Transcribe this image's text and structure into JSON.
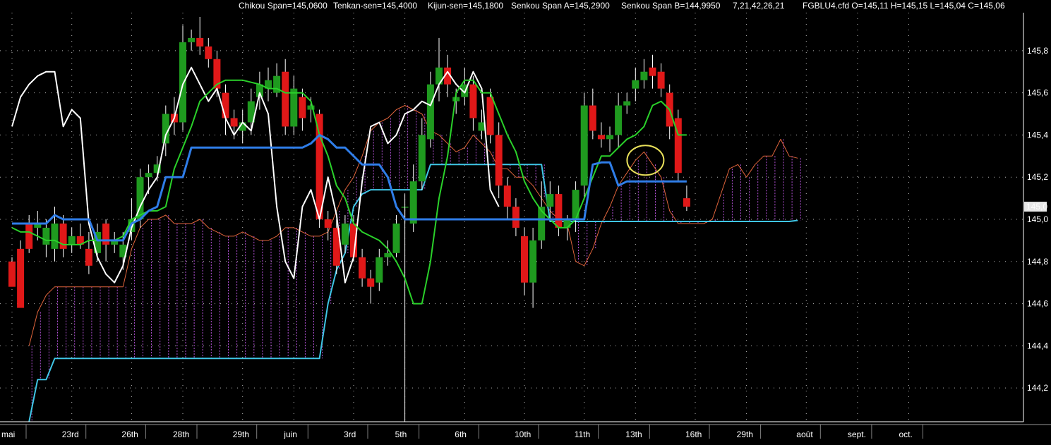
{
  "header": {
    "chikou": "Chikou Span=145,0600",
    "tenkan": "Tenkan-sen=145,4000",
    "kijun": "Kijun-sen=145,1800",
    "senkou_a": "Senkou Span A=145,2900",
    "senkou_b": "Senkou Span B=144,9950",
    "params": "7,21,42,26,21",
    "ohlc": "FGBLU4.cfd O=145,11 H=145,15 L=145,04 C=145,06"
  },
  "colors": {
    "background": "#000000",
    "bull": "#1f9a1f",
    "bear": "#e01818",
    "chikou": "#ffffff",
    "tenkan": "#2ad12a",
    "kijun": "#2f7de8",
    "senkou_a": "#e0643c",
    "senkou_b": "#3fc6e6",
    "cloud_hatch": "#b452d8",
    "highlight_circle": "#e8e05a",
    "grid": "#ffffff"
  },
  "chart_data": {
    "type": "candlestick",
    "instrument": "FGBLU4.cfd",
    "ylim": [
      144.04,
      145.98
    ],
    "y_ticks": [
      144.2,
      144.4,
      144.6,
      144.8,
      145.0,
      145.2,
      145.4,
      145.6,
      145.8
    ],
    "y_tick_labels": [
      "144,2",
      "144,4",
      "144,6",
      "144,8",
      "145,0",
      "145,2",
      "145,4",
      "145,6",
      "145,8"
    ],
    "last_price": 145.06,
    "last_price_label": "145,0",
    "n_slots": 107,
    "x_labels": [
      {
        "slot": 0,
        "label": "mai"
      },
      {
        "slot": 7,
        "label": "23rd"
      },
      {
        "slot": 14,
        "label": "26th"
      },
      {
        "slot": 20,
        "label": "28th"
      },
      {
        "slot": 27,
        "label": "29th"
      },
      {
        "slot": 33,
        "label": "juin"
      },
      {
        "slot": 40,
        "label": "3rd"
      },
      {
        "slot": 46,
        "label": "5th"
      },
      {
        "slot": 53,
        "label": "6th"
      },
      {
        "slot": 60,
        "label": "10th"
      },
      {
        "slot": 67,
        "label": "11th"
      },
      {
        "slot": 73,
        "label": "13th"
      },
      {
        "slot": 80,
        "label": "16th"
      },
      {
        "slot": 86,
        "label": "29th"
      },
      {
        "slot": 93,
        "label": "août"
      },
      {
        "slot": 99,
        "label": "sept."
      },
      {
        "slot": 105,
        "label": "oct."
      }
    ],
    "candles": [
      [
        144.8,
        144.68,
        144.82,
        144.7
      ],
      [
        144.86,
        144.58,
        144.9,
        144.66
      ],
      [
        144.98,
        144.86,
        145.02,
        144.84
      ],
      [
        144.96,
        144.98,
        145.04,
        144.9
      ],
      [
        144.88,
        144.96,
        145.0,
        144.82
      ],
      [
        144.86,
        144.98,
        145.06,
        144.8
      ],
      [
        144.98,
        144.86,
        145.02,
        144.82
      ],
      [
        144.88,
        144.92,
        144.96,
        144.84
      ],
      [
        144.92,
        144.88,
        144.98,
        144.86
      ],
      [
        144.86,
        144.78,
        144.94,
        144.74
      ],
      [
        144.84,
        144.94,
        144.98,
        144.8
      ],
      [
        144.98,
        144.88,
        145.0,
        144.8
      ],
      [
        144.88,
        144.9,
        144.94,
        144.84
      ],
      [
        144.82,
        144.88,
        144.94,
        144.76
      ],
      [
        144.94,
        145.0,
        145.1,
        144.9
      ],
      [
        145.0,
        145.2,
        145.24,
        144.96
      ],
      [
        145.2,
        145.22,
        145.26,
        145.12
      ],
      [
        145.22,
        145.26,
        145.3,
        145.18
      ],
      [
        145.36,
        145.5,
        145.54,
        145.3
      ],
      [
        145.5,
        145.46,
        145.58,
        145.4
      ],
      [
        145.46,
        145.84,
        145.92,
        145.42
      ],
      [
        145.84,
        145.86,
        145.9,
        145.8
      ],
      [
        145.86,
        145.82,
        145.96,
        145.78
      ],
      [
        145.82,
        145.76,
        145.86,
        145.72
      ],
      [
        145.76,
        145.62,
        145.8,
        145.58
      ],
      [
        145.6,
        145.48,
        145.64,
        145.4
      ],
      [
        145.48,
        145.44,
        145.52,
        145.38
      ],
      [
        145.42,
        145.46,
        145.52,
        145.36
      ],
      [
        145.46,
        145.56,
        145.62,
        145.4
      ],
      [
        145.58,
        145.64,
        145.7,
        145.52
      ],
      [
        145.62,
        145.66,
        145.72,
        145.56
      ],
      [
        145.6,
        145.68,
        145.74,
        145.58
      ],
      [
        145.7,
        145.44,
        145.76,
        145.4
      ],
      [
        145.44,
        145.62,
        145.68,
        145.4
      ],
      [
        145.58,
        145.48,
        145.62,
        145.42
      ],
      [
        145.52,
        145.54,
        145.58,
        145.46
      ],
      [
        145.5,
        145.0,
        145.52,
        144.96
      ],
      [
        145.0,
        144.96,
        145.04,
        144.9
      ],
      [
        144.96,
        144.78,
        145.0,
        144.74
      ],
      [
        144.88,
        144.98,
        145.02,
        144.84
      ],
      [
        144.98,
        144.82,
        145.02,
        144.8
      ],
      [
        144.82,
        144.72,
        144.86,
        144.68
      ],
      [
        144.72,
        144.68,
        144.76,
        144.6
      ],
      [
        144.7,
        144.82,
        144.86,
        144.66
      ],
      [
        144.82,
        144.84,
        144.9,
        144.78
      ],
      [
        144.84,
        144.98,
        145.02,
        144.82
      ],
      [
        145.06,
        145.06,
        145.12,
        144.98
      ],
      [
        144.98,
        145.18,
        145.26,
        144.94
      ],
      [
        145.18,
        145.4,
        145.48,
        145.14
      ],
      [
        145.38,
        145.64,
        145.7,
        145.34
      ],
      [
        145.64,
        145.72,
        145.86,
        145.56
      ],
      [
        145.72,
        145.64,
        145.78,
        145.58
      ],
      [
        145.56,
        145.58,
        145.62,
        145.5
      ],
      [
        145.58,
        145.64,
        145.72,
        145.54
      ],
      [
        145.64,
        145.48,
        145.68,
        145.42
      ],
      [
        145.42,
        145.46,
        145.52,
        145.38
      ],
      [
        145.58,
        145.4,
        145.62,
        145.36
      ],
      [
        145.4,
        145.16,
        145.46,
        145.1
      ],
      [
        145.16,
        145.06,
        145.2,
        145.0
      ],
      [
        145.06,
        144.96,
        145.1,
        144.92
      ],
      [
        144.92,
        144.7,
        144.96,
        144.64
      ],
      [
        144.7,
        144.9,
        144.96,
        144.58
      ],
      [
        144.9,
        145.06,
        145.18,
        144.86
      ],
      [
        145.06,
        145.12,
        145.18,
        145.0
      ],
      [
        145.12,
        144.96,
        145.16,
        144.92
      ],
      [
        144.96,
        145.0,
        145.02,
        144.9
      ],
      [
        145.0,
        145.14,
        145.18,
        144.94
      ],
      [
        145.16,
        145.54,
        145.6,
        145.1
      ],
      [
        145.54,
        145.42,
        145.62,
        145.38
      ],
      [
        145.4,
        145.38,
        145.46,
        145.34
      ],
      [
        145.38,
        145.4,
        145.44,
        145.32
      ],
      [
        145.4,
        145.54,
        145.6,
        145.34
      ],
      [
        145.54,
        145.56,
        145.6,
        145.5
      ],
      [
        145.62,
        145.66,
        145.72,
        145.56
      ],
      [
        145.66,
        145.7,
        145.76,
        145.62
      ],
      [
        145.72,
        145.68,
        145.78,
        145.62
      ],
      [
        145.7,
        145.62,
        145.74,
        145.58
      ],
      [
        145.6,
        145.44,
        145.64,
        145.38
      ],
      [
        145.48,
        145.22,
        145.52,
        145.18
      ],
      [
        145.1,
        145.06,
        145.16,
        145.04
      ]
    ],
    "series": [
      {
        "name": "Chikou Span",
        "values": [
          145.44,
          145.58,
          145.64,
          145.68,
          145.7,
          145.7,
          145.44,
          145.52,
          145.48,
          144.98,
          144.82,
          144.74,
          144.7,
          144.78,
          144.96,
          145.06,
          145.14,
          145.2,
          145.4,
          145.48,
          145.64,
          145.72,
          145.64,
          145.56,
          145.62,
          145.48,
          145.4,
          145.46,
          145.42,
          145.6,
          145.5,
          145.06,
          144.8,
          144.72,
          145.06,
          145.14,
          145.0,
          145.2,
          145.02,
          144.7,
          144.82,
          145.18,
          145.44,
          145.46,
          145.36,
          145.4,
          145.5,
          145.52,
          145.56,
          145.54,
          145.64,
          145.7,
          145.64,
          145.6,
          145.7,
          145.62,
          145.14,
          145.06
        ]
      },
      {
        "name": "Tenkan-sen",
        "values": [
          144.96,
          144.94,
          144.94,
          144.92,
          144.9,
          144.9,
          144.88,
          144.88,
          144.88,
          144.9,
          144.9,
          144.9,
          144.9,
          144.92,
          145.0,
          145.02,
          145.04,
          145.04,
          145.06,
          145.24,
          145.34,
          145.44,
          145.56,
          145.6,
          145.64,
          145.66,
          145.66,
          145.66,
          145.65,
          145.64,
          145.62,
          145.62,
          145.6,
          145.6,
          145.6,
          145.56,
          145.4,
          145.3,
          145.16,
          145.1,
          144.98,
          144.94,
          144.92,
          144.9,
          144.86,
          144.8,
          144.72,
          144.6,
          144.6,
          144.8,
          145.1,
          145.3,
          145.6,
          145.66,
          145.66,
          145.6,
          145.6,
          145.5,
          145.4,
          145.32,
          145.18,
          145.1,
          145.04,
          145.0,
          144.96,
          144.96,
          145.0,
          145.1,
          145.2,
          145.3,
          145.3,
          145.34,
          145.38,
          145.4,
          145.44,
          145.54,
          145.56,
          145.52,
          145.4,
          145.4
        ]
      },
      {
        "name": "Kijun-sen",
        "values": [
          144.98,
          144.98,
          144.98,
          144.98,
          144.98,
          145.02,
          145.0,
          145.0,
          145.0,
          145.0,
          144.9,
          144.9,
          144.9,
          144.9,
          144.98,
          145.0,
          145.04,
          145.06,
          145.2,
          145.2,
          145.2,
          145.34,
          145.34,
          145.34,
          145.34,
          145.34,
          145.34,
          145.34,
          145.34,
          145.34,
          145.34,
          145.34,
          145.34,
          145.34,
          145.34,
          145.36,
          145.4,
          145.38,
          145.34,
          145.34,
          145.3,
          145.26,
          145.26,
          145.26,
          145.2,
          145.06,
          145.0,
          145.0,
          145.0,
          145.0,
          145.0,
          145.0,
          145.0,
          145.0,
          145.0,
          145.0,
          145.0,
          145.0,
          145.0,
          145.0,
          145.0,
          145.0,
          145.0,
          145.0,
          145.0,
          145.0,
          145.0,
          145.0,
          145.26,
          145.27,
          145.27,
          145.16,
          145.18,
          145.18,
          145.18,
          145.18,
          145.18,
          145.18,
          145.18,
          145.18
        ]
      },
      {
        "name": "Senkou Span A",
        "values": [
          null,
          null,
          144.4,
          144.56,
          144.64,
          144.68,
          144.68,
          144.68,
          144.68,
          144.68,
          144.68,
          144.68,
          144.68,
          144.68,
          144.86,
          144.96,
          145.0,
          145.0,
          145.02,
          144.98,
          144.98,
          144.98,
          145.0,
          144.96,
          144.94,
          144.92,
          144.92,
          144.94,
          144.92,
          144.9,
          144.9,
          144.92,
          144.96,
          144.96,
          144.94,
          144.92,
          144.92,
          144.94,
          145.04,
          145.14,
          145.2,
          145.3,
          145.42,
          145.46,
          145.48,
          145.52,
          145.54,
          145.52,
          145.5,
          145.42,
          145.4,
          145.36,
          145.32,
          145.34,
          145.4,
          145.36,
          145.32,
          145.24,
          145.24,
          145.2,
          145.2,
          145.16,
          145.1,
          145.04,
          145.0,
          144.98,
          144.8,
          144.78,
          144.86,
          144.98,
          145.06,
          145.16,
          145.22,
          145.28,
          145.32,
          145.26,
          145.2,
          145.04,
          144.98,
          144.98,
          144.98,
          144.98,
          145.0,
          145.12,
          145.24,
          145.26,
          145.2,
          145.26,
          145.3,
          145.3,
          145.38,
          145.3,
          145.29
        ]
      },
      {
        "name": "Senkou Span B",
        "values": [
          null,
          null,
          144.04,
          144.24,
          144.24,
          144.34,
          144.34,
          144.34,
          144.34,
          144.34,
          144.34,
          144.34,
          144.34,
          144.34,
          144.34,
          144.34,
          144.34,
          144.34,
          144.34,
          144.34,
          144.34,
          144.34,
          144.34,
          144.34,
          144.34,
          144.34,
          144.34,
          144.34,
          144.34,
          144.34,
          144.34,
          144.34,
          144.34,
          144.34,
          144.34,
          144.34,
          144.34,
          144.6,
          144.76,
          144.84,
          145.06,
          145.12,
          145.14,
          145.14,
          145.14,
          145.14,
          145.14,
          145.14,
          145.14,
          145.26,
          145.26,
          145.26,
          145.26,
          145.26,
          145.26,
          145.26,
          145.26,
          145.26,
          145.26,
          145.26,
          145.26,
          145.26,
          145.26,
          144.99,
          144.99,
          144.99,
          144.99,
          144.99,
          144.99,
          144.99,
          144.99,
          144.99,
          144.99,
          144.99,
          144.99,
          144.99,
          144.99,
          144.99,
          144.99,
          144.99,
          144.99,
          144.99,
          144.99,
          144.99,
          144.99,
          144.99,
          144.99,
          144.99,
          144.99,
          144.99,
          144.99,
          144.99,
          144.995
        ]
      }
    ],
    "annotation": {
      "type": "ellipse",
      "slot": 74,
      "value": 145.28
    }
  }
}
